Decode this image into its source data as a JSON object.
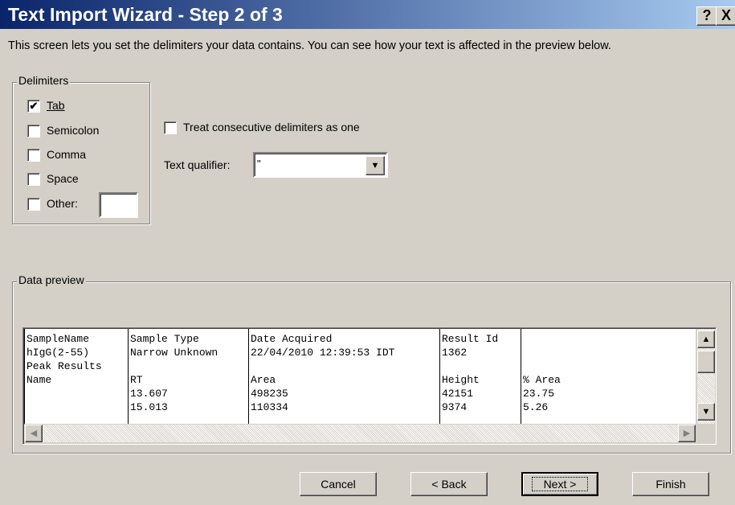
{
  "window": {
    "title": "Text Import Wizard - Step 2 of 3",
    "help_glyph": "?",
    "close_glyph": "X"
  },
  "description": "This screen lets you set the delimiters your data contains.  You can see how your text is affected in the preview below.",
  "delimiters": {
    "legend": "Delimiters",
    "tab": {
      "label": "Tab",
      "checked": true
    },
    "semicolon": {
      "label": "Semicolon",
      "checked": false
    },
    "comma": {
      "label": "Comma",
      "checked": false
    },
    "space": {
      "label": "Space",
      "checked": false
    },
    "other": {
      "label": "Other:",
      "checked": false,
      "value": ""
    }
  },
  "consecutive": {
    "label": "Treat consecutive delimiters as one",
    "checked": false
  },
  "qualifier": {
    "label": "Text qualifier:",
    "value": "\""
  },
  "preview": {
    "legend": "Data preview",
    "columns": [
      [
        "SampleName",
        "hIgG(2-55)",
        "Peak Results",
        "Name",
        "",
        ""
      ],
      [
        "Sample Type",
        "Narrow Unknown",
        "",
        "RT",
        "13.607",
        "15.013"
      ],
      [
        "Date Acquired",
        "22/04/2010 12:39:53 IDT",
        "",
        "Area",
        "498235",
        "110334"
      ],
      [
        "Result Id",
        "1362",
        "",
        "Height",
        "42151",
        "9374"
      ],
      [
        "",
        "",
        "",
        "% Area",
        "23.75",
        "5.26"
      ]
    ]
  },
  "buttons": {
    "cancel": "Cancel",
    "back": "< Back",
    "next": "Next >",
    "finish": "Finish"
  },
  "icons": {
    "check": "✔",
    "up": "▲",
    "down": "▼",
    "left": "◀",
    "right": "▶"
  }
}
